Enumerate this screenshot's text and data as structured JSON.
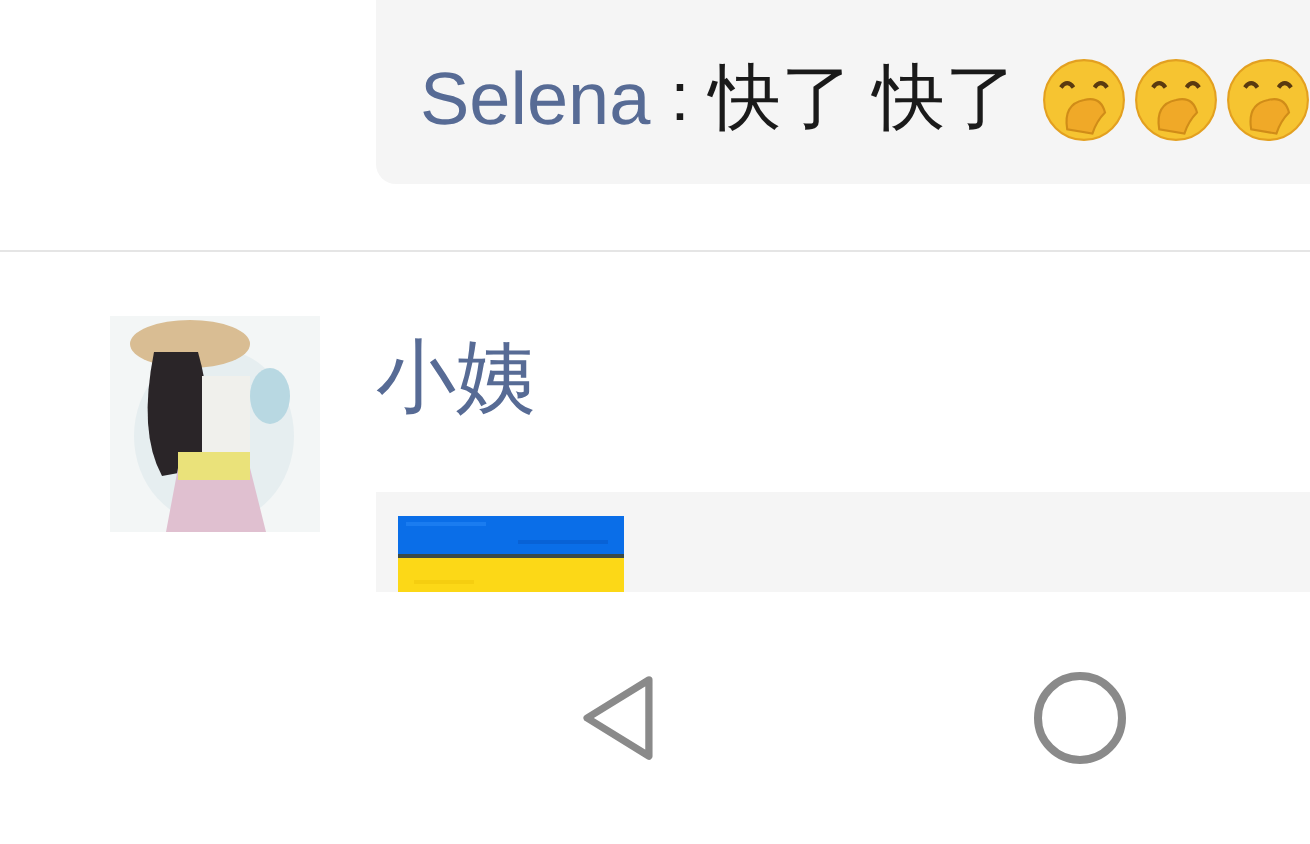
{
  "comment": {
    "author": "Selena",
    "separator": ":",
    "text": "快了 快了"
  },
  "post": {
    "author": "小姨"
  }
}
